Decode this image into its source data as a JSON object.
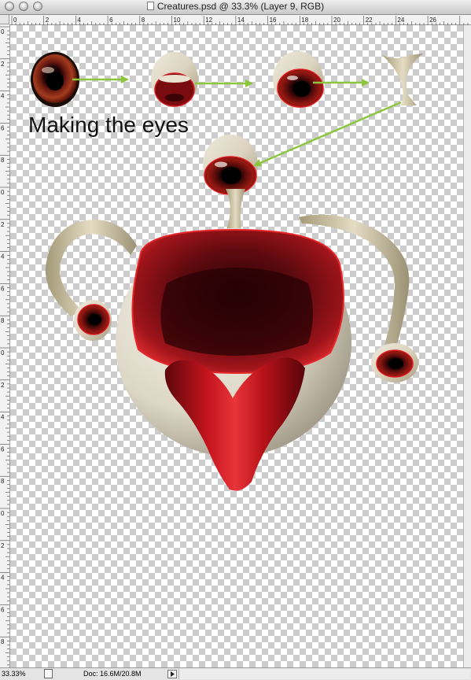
{
  "window": {
    "title": "Creatures.psd @ 33.3% (Layer 9, RGB)",
    "buttons": [
      "close-button",
      "minimize-button",
      "zoom-button"
    ]
  },
  "rulers": {
    "horizontal_labels": [
      "0",
      "2",
      "4",
      "6",
      "8",
      "10",
      "12",
      "14",
      "16",
      "18",
      "20",
      "22",
      "24",
      "26"
    ],
    "vertical_labels": [
      "0",
      "2",
      "4",
      "6",
      "8",
      "0",
      "2",
      "4",
      "6",
      "8",
      "0",
      "2",
      "4",
      "6",
      "8",
      "0",
      "2",
      "4",
      "6",
      "8",
      "0"
    ]
  },
  "canvas": {
    "caption": "Making the eyes",
    "colors": {
      "eyeball_red": "#8e0f14",
      "flesh": "#e3ddcc",
      "stalk": "#cfc6ab",
      "arrow": "#8cc63f"
    }
  },
  "statusbar": {
    "zoom": "33.33%",
    "doc_info": "Doc: 16.6M/20.8M"
  }
}
